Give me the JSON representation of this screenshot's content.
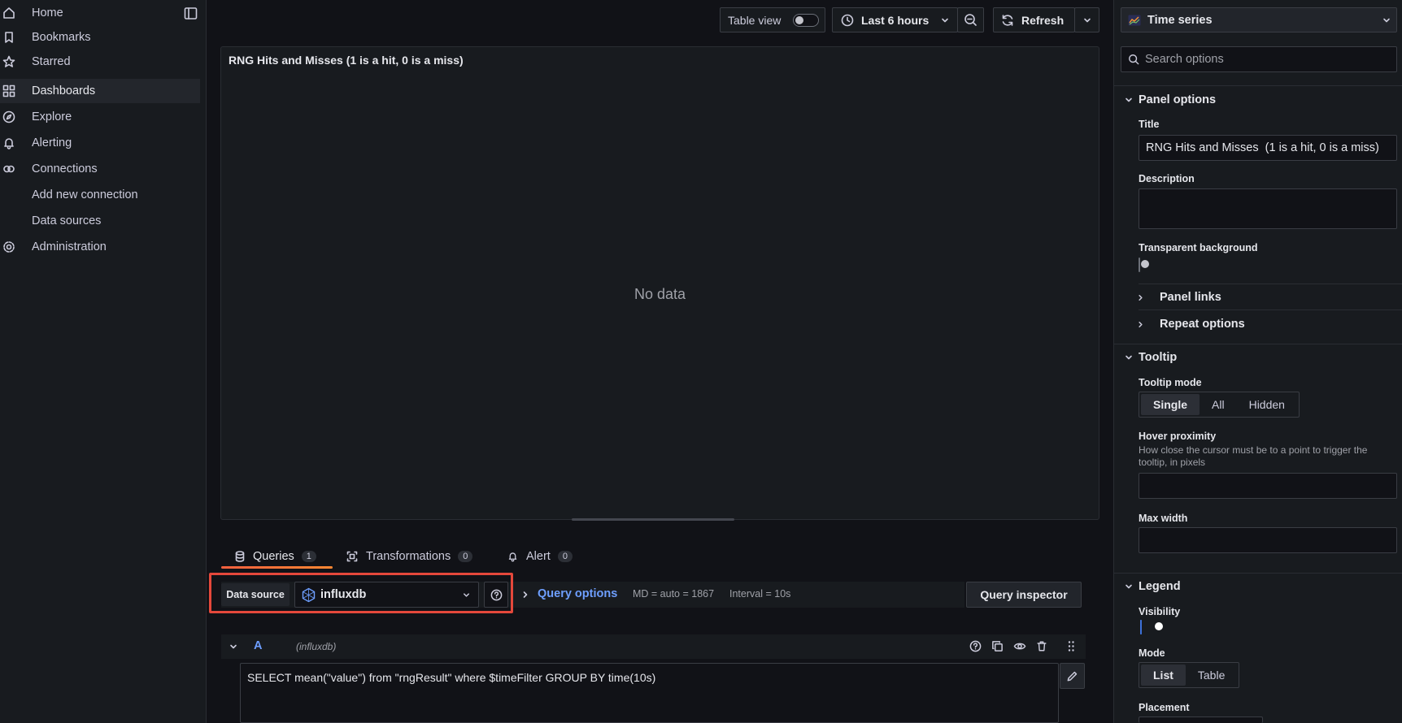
{
  "sidebar": {
    "items": [
      {
        "label": "Home",
        "icon": "home-icon"
      },
      {
        "label": "Bookmarks",
        "icon": "bookmark-icon"
      },
      {
        "label": "Starred",
        "icon": "star-icon"
      },
      {
        "label": "Dashboards",
        "icon": "apps-icon"
      },
      {
        "label": "Explore",
        "icon": "compass-icon"
      },
      {
        "label": "Alerting",
        "icon": "bell-icon"
      },
      {
        "label": "Connections",
        "icon": "link-icon"
      },
      {
        "label": "Add new connection",
        "icon": ""
      },
      {
        "label": "Data sources",
        "icon": ""
      },
      {
        "label": "Administration",
        "icon": "gear-icon"
      }
    ]
  },
  "toolbar": {
    "table_view_label": "Table view",
    "table_view_on": false,
    "time_range": "Last 6 hours",
    "refresh_label": "Refresh"
  },
  "panel": {
    "title": "RNG Hits and Misses (1 is a hit, 0 is a miss)",
    "no_data": "No data"
  },
  "tabs": [
    {
      "label": "Queries",
      "count": "1",
      "icon": "database-icon"
    },
    {
      "label": "Transformations",
      "count": "0",
      "icon": "transform-icon"
    },
    {
      "label": "Alert",
      "count": "0",
      "icon": "bell-icon"
    }
  ],
  "query_bar": {
    "data_source_label": "Data source",
    "data_source_value": "influxdb",
    "query_options_label": "Query options",
    "md_info": "MD = auto = 1867",
    "interval_info": "Interval = 10s",
    "inspector_label": "Query inspector"
  },
  "query": {
    "ref_id": "A",
    "source": "(influxdb)",
    "text": "SELECT mean(\"value\") from \"rngResult\" where $timeFilter GROUP BY time(10s)"
  },
  "options": {
    "viz_type": "Time series",
    "search_placeholder": "Search options",
    "panel_options": {
      "heading": "Panel options",
      "title_label": "Title",
      "title_value": "RNG Hits and Misses  (1 is a hit, 0 is a miss)",
      "description_label": "Description",
      "transparent_label": "Transparent background",
      "transparent_on": false,
      "panel_links": "Panel links",
      "repeat_options": "Repeat options"
    },
    "tooltip": {
      "heading": "Tooltip",
      "mode_label": "Tooltip mode",
      "modes": [
        "Single",
        "All",
        "Hidden"
      ],
      "selected_mode": "Single",
      "hover_label": "Hover proximity",
      "hover_desc": "How close the cursor must be to a point to trigger the tooltip, in pixels",
      "max_width_label": "Max width"
    },
    "legend": {
      "heading": "Legend",
      "visibility_label": "Visibility",
      "visibility_on": true,
      "mode_label": "Mode",
      "modes": [
        "List",
        "Table"
      ],
      "selected_mode": "List",
      "placement_label": "Placement"
    }
  },
  "colors": {
    "highlight": "#e5483b",
    "accent_blue": "#6e9fff",
    "tab_underline": "#f55f3e"
  }
}
